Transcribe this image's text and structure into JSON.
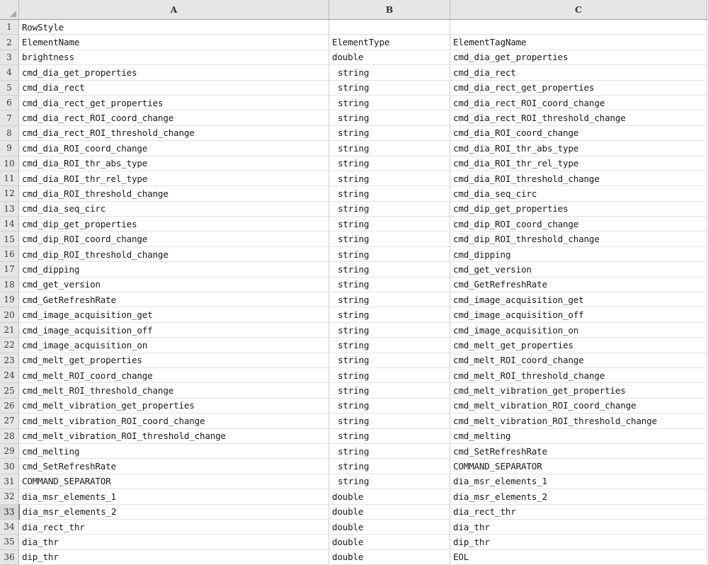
{
  "app": {
    "type": "spreadsheet-grid",
    "select_all_icon": "select-all-triangle-icon"
  },
  "columns": [
    {
      "id": "A",
      "label": "A"
    },
    {
      "id": "B",
      "label": "B"
    },
    {
      "id": "C",
      "label": "C"
    }
  ],
  "active_row": 33,
  "rows": [
    {
      "n": "1",
      "a": "RowStyle",
      "b": "",
      "c": ""
    },
    {
      "n": "2",
      "a": "ElementName",
      "b": "ElementType",
      "c": "ElementTagName"
    },
    {
      "n": "3",
      "a": "brightness",
      "b": "double",
      "c": "cmd_dia_get_properties"
    },
    {
      "n": "4",
      "a": "cmd_dia_get_properties",
      "b": "string",
      "c": "cmd_dia_rect"
    },
    {
      "n": "5",
      "a": "cmd_dia_rect",
      "b": "string",
      "c": "cmd_dia_rect_get_properties"
    },
    {
      "n": "6",
      "a": "cmd_dia_rect_get_properties",
      "b": "string",
      "c": "cmd_dia_rect_ROI_coord_change"
    },
    {
      "n": "7",
      "a": "cmd_dia_rect_ROI_coord_change",
      "b": "string",
      "c": "cmd_dia_rect_ROI_threshold_change"
    },
    {
      "n": "8",
      "a": "cmd_dia_rect_ROI_threshold_change",
      "b": "string",
      "c": "cmd_dia_ROI_coord_change"
    },
    {
      "n": "9",
      "a": "cmd_dia_ROI_coord_change",
      "b": "string",
      "c": "cmd_dia_ROI_thr_abs_type"
    },
    {
      "n": "10",
      "a": "cmd_dia_ROI_thr_abs_type",
      "b": "string",
      "c": "cmd_dia_ROI_thr_rel_type"
    },
    {
      "n": "11",
      "a": "cmd_dia_ROI_thr_rel_type",
      "b": "string",
      "c": "cmd_dia_ROI_threshold_change"
    },
    {
      "n": "12",
      "a": "cmd_dia_ROI_threshold_change",
      "b": "string",
      "c": "cmd_dia_seq_circ"
    },
    {
      "n": "13",
      "a": "cmd_dia_seq_circ",
      "b": "string",
      "c": "cmd_dip_get_properties"
    },
    {
      "n": "14",
      "a": "cmd_dip_get_properties",
      "b": "string",
      "c": "cmd_dip_ROI_coord_change"
    },
    {
      "n": "15",
      "a": "cmd_dip_ROI_coord_change",
      "b": "string",
      "c": "cmd_dip_ROI_threshold_change"
    },
    {
      "n": "16",
      "a": "cmd_dip_ROI_threshold_change",
      "b": "string",
      "c": "cmd_dipping"
    },
    {
      "n": "17",
      "a": "cmd_dipping",
      "b": "string",
      "c": "cmd_get_version"
    },
    {
      "n": "18",
      "a": "cmd_get_version",
      "b": "string",
      "c": "cmd_GetRefreshRate"
    },
    {
      "n": "19",
      "a": "cmd_GetRefreshRate",
      "b": "string",
      "c": "cmd_image_acquisition_get"
    },
    {
      "n": "20",
      "a": "cmd_image_acquisition_get",
      "b": "string",
      "c": "cmd_image_acquisition_off"
    },
    {
      "n": "21",
      "a": "cmd_image_acquisition_off",
      "b": "string",
      "c": "cmd_image_acquisition_on"
    },
    {
      "n": "22",
      "a": "cmd_image_acquisition_on",
      "b": "string",
      "c": "cmd_melt_get_properties"
    },
    {
      "n": "23",
      "a": "cmd_melt_get_properties",
      "b": "string",
      "c": "cmd_melt_ROI_coord_change"
    },
    {
      "n": "24",
      "a": "cmd_melt_ROI_coord_change",
      "b": "string",
      "c": "cmd_melt_ROI_threshold_change"
    },
    {
      "n": "25",
      "a": "cmd_melt_ROI_threshold_change",
      "b": "string",
      "c": "cmd_melt_vibration_get_properties"
    },
    {
      "n": "26",
      "a": "cmd_melt_vibration_get_properties",
      "b": "string",
      "c": "cmd_melt_vibration_ROI_coord_change"
    },
    {
      "n": "27",
      "a": "cmd_melt_vibration_ROI_coord_change",
      "b": "string",
      "c": "cmd_melt_vibration_ROI_threshold_change"
    },
    {
      "n": "28",
      "a": "cmd_melt_vibration_ROI_threshold_change",
      "b": "string",
      "c": "cmd_melting"
    },
    {
      "n": "29",
      "a": "cmd_melting",
      "b": "string",
      "c": "cmd_SetRefreshRate"
    },
    {
      "n": "30",
      "a": "cmd_SetRefreshRate",
      "b": "string",
      "c": "COMMAND_SEPARATOR"
    },
    {
      "n": "31",
      "a": "COMMAND_SEPARATOR",
      "b": "string",
      "c": "dia_msr_elements_1"
    },
    {
      "n": "32",
      "a": "dia_msr_elements_1",
      "b": "double",
      "c": "dia_msr_elements_2"
    },
    {
      "n": "33",
      "a": "dia_msr_elements_2",
      "b": "double",
      "c": "dia_rect_thr"
    },
    {
      "n": "34",
      "a": "dia_rect_thr",
      "b": "double",
      "c": "dia_thr"
    },
    {
      "n": "35",
      "a": "dia_thr",
      "b": "double",
      "c": "dip_thr"
    },
    {
      "n": "36",
      "a": "dip_thr",
      "b": "double",
      "c": "EOL"
    }
  ]
}
